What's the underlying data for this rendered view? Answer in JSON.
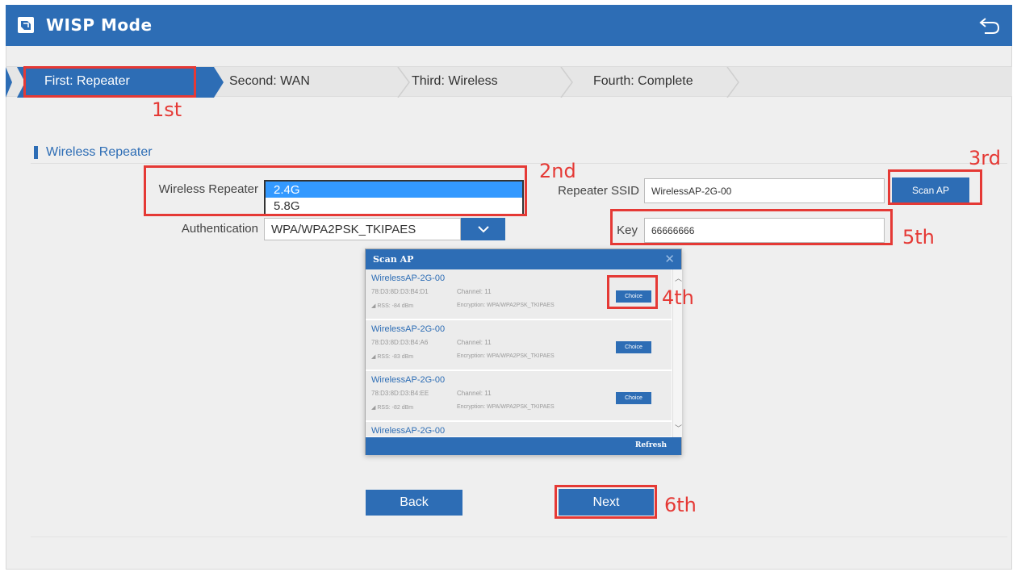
{
  "header": {
    "title": "WISP Mode",
    "logo_icon": "router-icon",
    "back_icon": "return-arrow-icon"
  },
  "steps": [
    {
      "label": "First: Repeater",
      "active": true
    },
    {
      "label": "Second: WAN",
      "active": false
    },
    {
      "label": "Third: Wireless",
      "active": false
    },
    {
      "label": "Fourth: Complete",
      "active": false
    }
  ],
  "section": {
    "title": "Wireless Repeater"
  },
  "form": {
    "repeater_label": "Wireless Repeater",
    "band_options": [
      "2.4G",
      "5.8G"
    ],
    "band_selected": "2.4G",
    "auth_label": "Authentication",
    "auth_value": "WPA/WPA2PSK_TKIPAES",
    "ssid_label": "Repeater SSID",
    "ssid_value": "WirelessAP-2G-00",
    "scan_label": "Scan AP",
    "key_label": "Key",
    "key_value": "66666666"
  },
  "modal": {
    "title": "Scan AP",
    "close_icon": "close-icon",
    "choice_label": "Choice",
    "refresh_label": "Refresh",
    "channel_label": "Channel:",
    "rss_label": "RSS:",
    "enc_label": "Encryption:",
    "items": [
      {
        "ssid": "WirelessAP-2G-00",
        "mac": "78:D3:8D:D3:B4:D1",
        "channel": "11",
        "rss": "-84 dBm",
        "encryption": "WPA/WPA2PSK_TKIPAES"
      },
      {
        "ssid": "WirelessAP-2G-00",
        "mac": "78:D3:8D:D3:B4:A6",
        "channel": "11",
        "rss": "-83 dBm",
        "encryption": "WPA/WPA2PSK_TKIPAES"
      },
      {
        "ssid": "WirelessAP-2G-00",
        "mac": "78:D3:8D:D3:B4:EE",
        "channel": "11",
        "rss": "-82 dBm",
        "encryption": "WPA/WPA2PSK_TKIPAES"
      },
      {
        "ssid": "WirelessAP-2G-00"
      }
    ]
  },
  "buttons": {
    "back": "Back",
    "next": "Next"
  },
  "annotations": {
    "a1": "1st",
    "a2": "2nd",
    "a3": "3rd",
    "a4": "4th",
    "a5": "5th",
    "a6": "6th"
  },
  "colors": {
    "primary": "#2d6db5",
    "annotation": "#e53935",
    "selected_option": "#3399ff"
  }
}
